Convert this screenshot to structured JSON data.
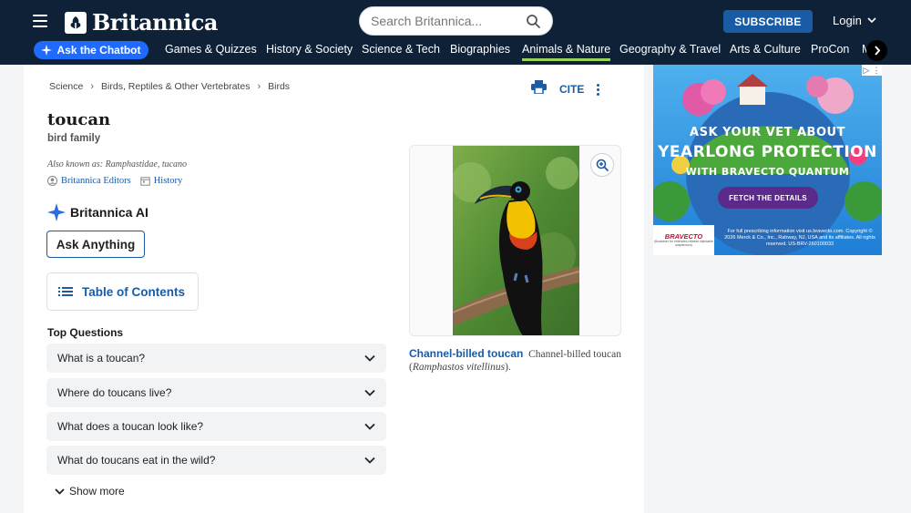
{
  "header": {
    "logo_text": "Britannica",
    "search_placeholder": "Search Britannica...",
    "subscribe_label": "SUBSCRIBE",
    "login_label": "Login"
  },
  "nav": {
    "chatbot_label": "Ask the Chatbot",
    "items": [
      "Games & Quizzes",
      "History & Society",
      "Science & Tech",
      "Biographies",
      "Animals & Nature",
      "Geography & Travel",
      "Arts & Culture",
      "ProCon",
      "M"
    ],
    "active_index": 4,
    "accent_color": "#9bd35a"
  },
  "breadcrumb": [
    "Science",
    "Birds, Reptiles & Other Vertebrates",
    "Birds"
  ],
  "article": {
    "title": "toucan",
    "subtitle": "bird family",
    "also_known_as": "Also known as: Ramphastidae, tucano",
    "editors_label": "Britannica Editors",
    "history_label": "History",
    "cite_label": "CITE"
  },
  "ai": {
    "heading": "Britannica AI",
    "ask_button": "Ask Anything"
  },
  "toc_label": "Table of Contents",
  "top_questions": {
    "heading": "Top Questions",
    "items": [
      "What is a toucan?",
      "Where do toucans live?",
      "What does a toucan look like?",
      "What do toucans eat in the wild?"
    ],
    "show_more": "Show more"
  },
  "figure": {
    "caption_title": "Channel-billed toucan",
    "caption_text": "Channel-billed toucan",
    "caption_scientific": "Ramphastos vitellinus",
    "caption_end": ")."
  },
  "ad": {
    "line1": "ASK YOUR VET ABOUT",
    "line2": "YEARLONG PROTECTION",
    "line3": "WITH BRAVECTO QUANTUM",
    "button": "FETCH THE DETAILS",
    "logo_word": "BRAVECTO",
    "logo_sub": "(fluralaner for extended-release injectable suspension)",
    "fine_print": "For full prescribing information visit us.bravecto.com. Copyright © 2026 Merck & Co., Inc., Rahway, NJ, USA and its affiliates. All rights reserved. US-BRV-260100033"
  }
}
